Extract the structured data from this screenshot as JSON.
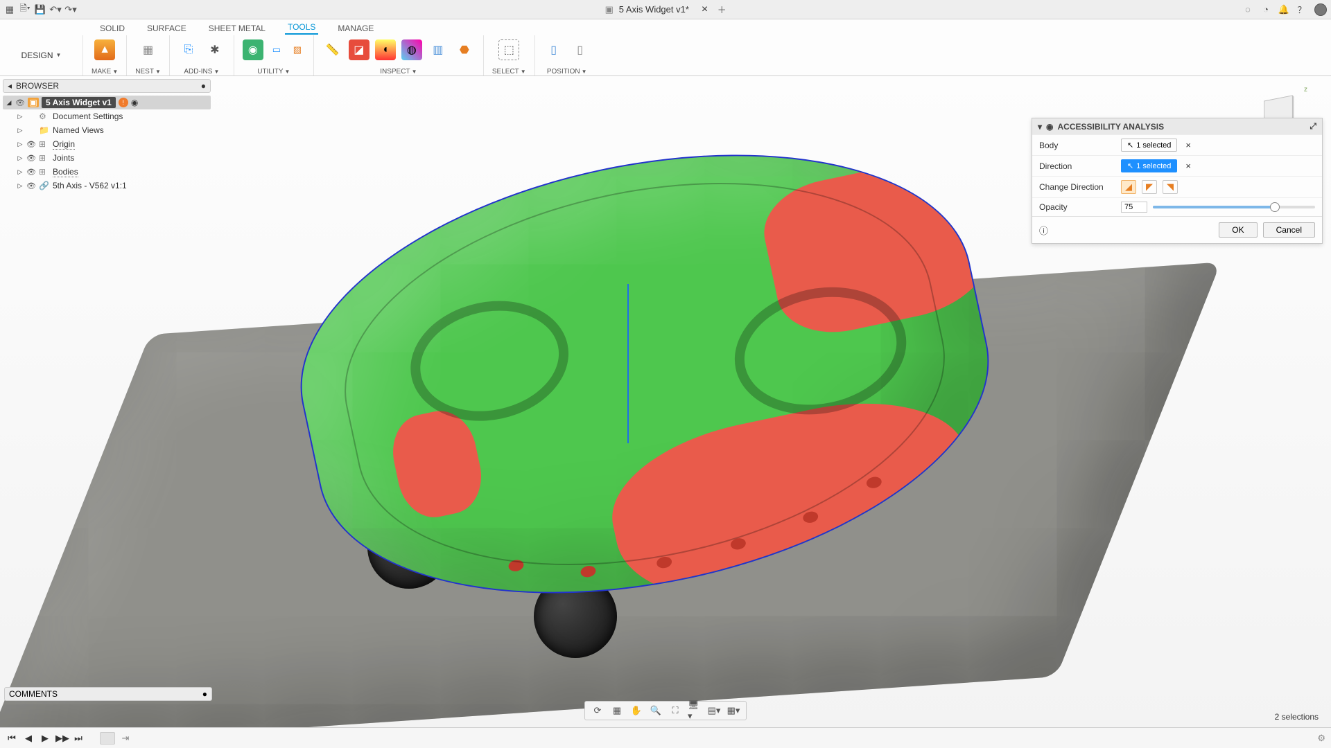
{
  "app": {
    "title": "5 Axis Widget v1*"
  },
  "ribbon": {
    "workspace": "DESIGN",
    "tabs": [
      "SOLID",
      "SURFACE",
      "SHEET METAL",
      "TOOLS",
      "MANAGE"
    ],
    "active_tab": "TOOLS",
    "groups": {
      "make": "MAKE",
      "nest": "NEST",
      "addins": "ADD-INS",
      "utility": "UTILITY",
      "inspect": "INSPECT",
      "select": "SELECT",
      "position": "POSITION"
    }
  },
  "browser": {
    "title": "BROWSER",
    "root": "5 Axis Widget v1",
    "badge": "●",
    "items": [
      {
        "label": "Document Settings",
        "dotted": false,
        "icon": "⚙"
      },
      {
        "label": "Named Views",
        "dotted": false,
        "icon": "📁"
      },
      {
        "label": "Origin",
        "dotted": true,
        "icon": "🞵"
      },
      {
        "label": "Joints",
        "dotted": false,
        "icon": "🞵"
      },
      {
        "label": "Bodies",
        "dotted": true,
        "icon": "🞵"
      },
      {
        "label": "5th Axis - V562 v1:1",
        "dotted": false,
        "icon": "🔗"
      }
    ]
  },
  "analysis": {
    "title": "ACCESSIBILITY ANALYSIS",
    "rows": {
      "body": {
        "label": "Body",
        "value": "1 selected"
      },
      "direction": {
        "label": "Direction",
        "value": "1 selected"
      },
      "change_direction": {
        "label": "Change Direction"
      },
      "opacity": {
        "label": "Opacity",
        "value": "75"
      }
    },
    "buttons": {
      "ok": "OK",
      "cancel": "Cancel"
    }
  },
  "comments": {
    "title": "COMMENTS"
  },
  "status": {
    "text": "2 selections"
  },
  "viewcube": {
    "axis": "z"
  }
}
